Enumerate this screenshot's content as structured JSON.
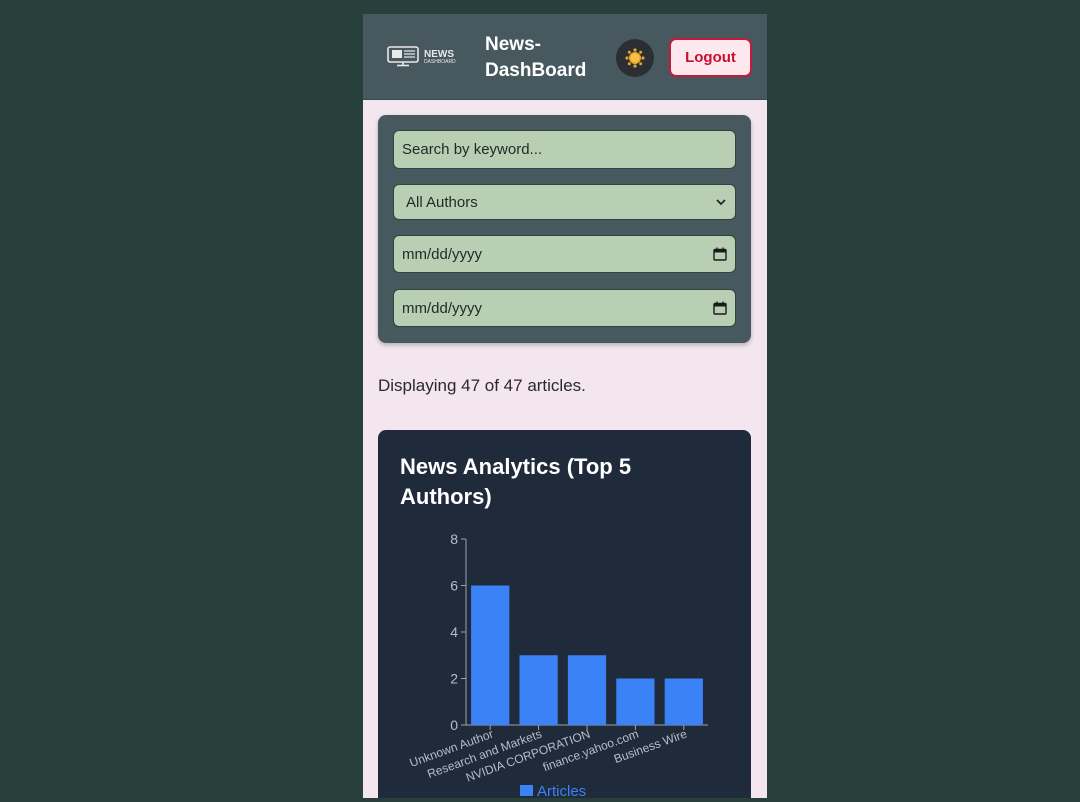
{
  "header": {
    "logo_text_top": "NEWS",
    "logo_text_bottom": "DASHBOARD",
    "brand_title": "News-DashBoard",
    "theme_icon": "sun-icon",
    "logout_label": "Logout"
  },
  "filters": {
    "search_placeholder": "Search by keyword...",
    "author_selected": "All Authors",
    "date_from_placeholder": "mm/dd/yyyy",
    "date_to_placeholder": "mm/dd/yyyy"
  },
  "summary": {
    "text": "Displaying 47 of 47 articles."
  },
  "analytics": {
    "title": "News Analytics (Top 5 Authors)"
  },
  "colors": {
    "bar": "#3b82f6",
    "panel": "#1f2a3b",
    "header": "#47595f",
    "field": "#b9cfb3",
    "logout": "#c8102e"
  },
  "chart_data": {
    "type": "bar",
    "categories": [
      "Unknown Author",
      "Research and Markets",
      "NVIDIA CORPORATION",
      "finance.yahoo.com",
      "Business Wire"
    ],
    "series": [
      {
        "name": "Articles",
        "values": [
          6,
          3,
          3,
          2,
          2
        ]
      }
    ],
    "yticks": [
      0,
      2,
      4,
      6,
      8
    ],
    "ylim": [
      0,
      8
    ],
    "legend": "bottom"
  }
}
